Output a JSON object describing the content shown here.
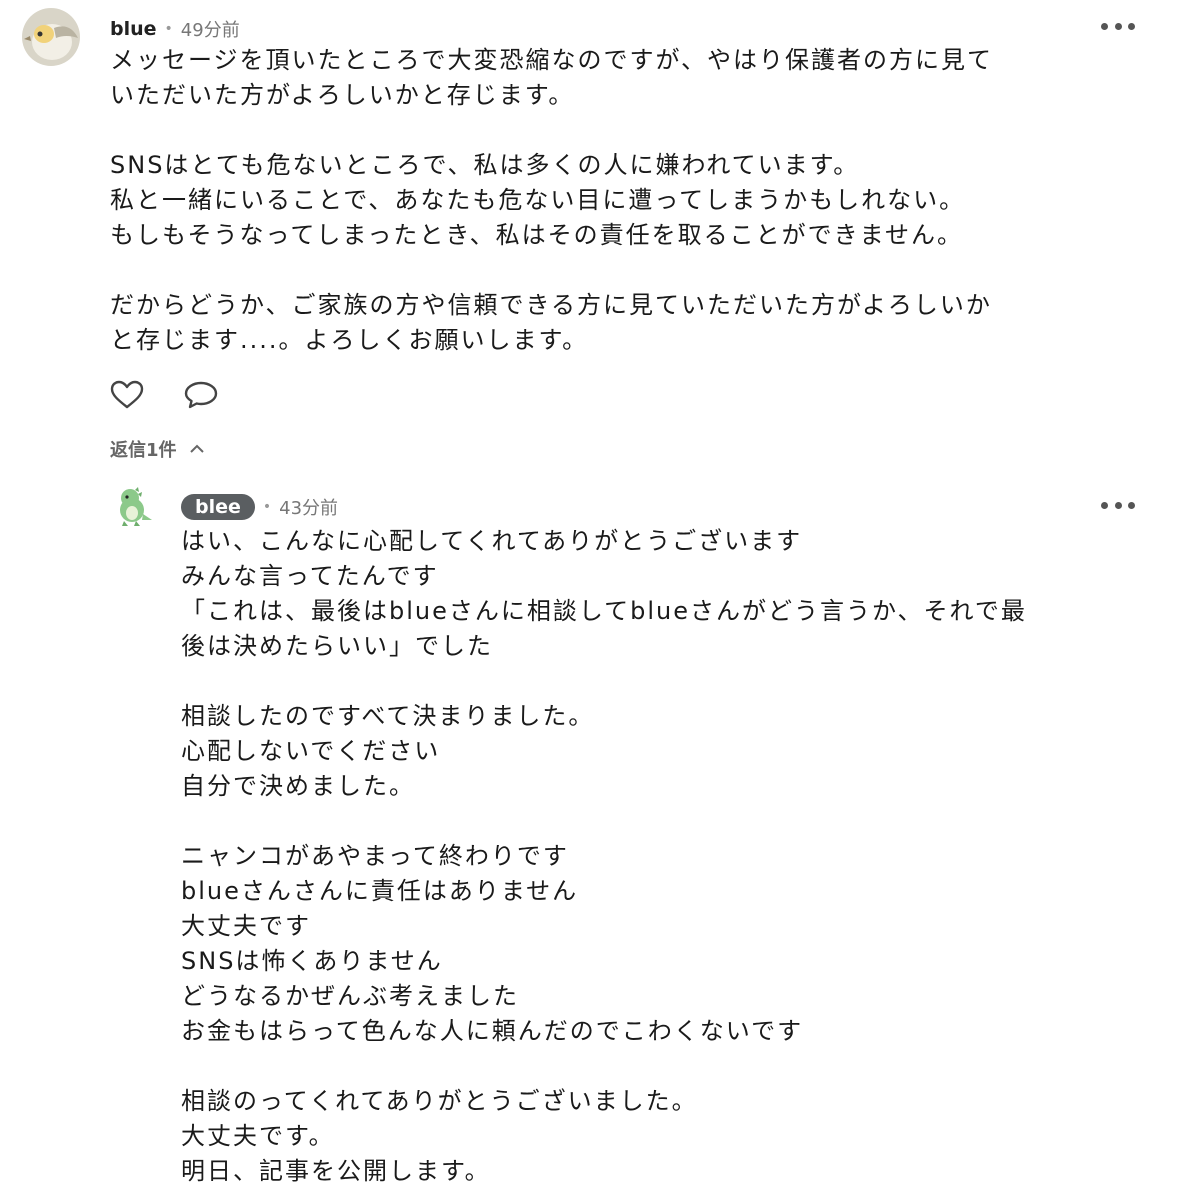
{
  "comment1": {
    "username": "blue",
    "time": "49分前",
    "lines": [
      "メッセージを頂いたところで大変恐縮なのですが、やはり保護者の方に見て",
      "いただいた方がよろしいかと存じます。",
      "",
      "SNSはとても危ないところで、私は多くの人に嫌われています。",
      "私と一緒にいることで、あなたも危ない目に遭ってしまうかもしれない。",
      "もしもそうなってしまったとき、私はその責任を取ることができません。",
      "",
      "だからどうか、ご家族の方や信頼できる方に見ていただいた方がよろしいか",
      "と存じます....。よろしくお願いします。"
    ],
    "replies_label": "返信1件",
    "icons": {
      "like": "heart-icon",
      "reply": "speech-bubble-icon",
      "more": "more-dots-icon"
    }
  },
  "comment2": {
    "username": "blee",
    "time": "43分前",
    "lines": [
      "はい、こんなに心配してくれてありがとうございます",
      "みんな言ってたんです",
      "「これは、最後はblueさんに相談してblueさんがどう言うか、それで最",
      "後は決めたらいい」でした",
      "",
      "相談したのですべて決まりました。",
      "心配しないでください",
      "自分で決めました。",
      "",
      "ニャンコがあやまって終わりです",
      "blueさんさんに責任はありません",
      "大丈夫です",
      "SNSは怖くありません",
      "どうなるかぜんぶ考えました",
      "お金もはらって色んな人に頼んだのでこわくないです",
      "",
      "相談のってくれてありがとうございました。",
      "大丈夫です。",
      "明日、記事を公開します。"
    ],
    "icons": {
      "more": "more-dots-icon"
    }
  },
  "colors": {
    "text": "#1a1a1a",
    "meta": "#777777",
    "pill": "#5a5e61"
  }
}
